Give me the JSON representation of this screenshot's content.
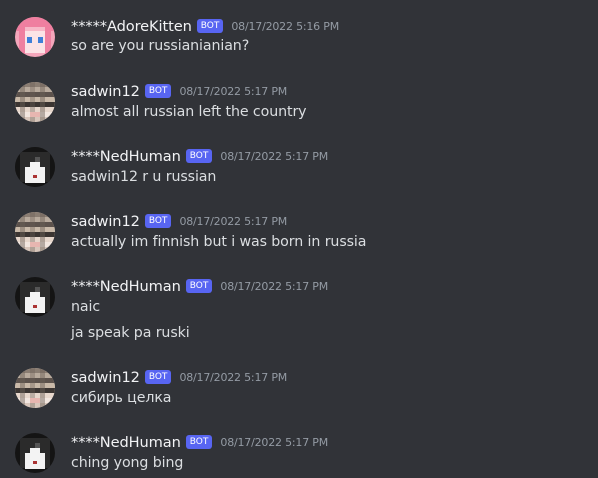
{
  "messages": [
    {
      "avatar": "pink-hair-anime-avatar-icon",
      "username": "*****AdoreKitten",
      "tag": "BOT",
      "timestamp": "08/17/2022 5:16 PM",
      "lines": [
        "so are you russianianian?"
      ]
    },
    {
      "avatar": "pixelated-blurred-avatar-icon",
      "username": "sadwin12",
      "tag": "BOT",
      "timestamp": "08/17/2022 5:17 PM",
      "lines": [
        "almost all russian left the country"
      ]
    },
    {
      "avatar": "black-hair-pixel-avatar-icon",
      "username": "****NedHuman",
      "tag": "BOT",
      "timestamp": "08/17/2022 5:17 PM",
      "lines": [
        "sadwin12 r u russian"
      ]
    },
    {
      "avatar": "pixelated-blurred-avatar-icon",
      "username": "sadwin12",
      "tag": "BOT",
      "timestamp": "08/17/2022 5:17 PM",
      "lines": [
        "actually im finnish but i was born in russia"
      ]
    },
    {
      "avatar": "black-hair-pixel-avatar-icon",
      "username": "****NedHuman",
      "tag": "BOT",
      "timestamp": "08/17/2022 5:17 PM",
      "lines": [
        "naic",
        "ja speak pa ruski"
      ]
    },
    {
      "avatar": "pixelated-blurred-avatar-icon",
      "username": "sadwin12",
      "tag": "BOT",
      "timestamp": "08/17/2022 5:17 PM",
      "lines": [
        "сибирь целка"
      ]
    },
    {
      "avatar": "black-hair-pixel-avatar-icon",
      "username": "****NedHuman",
      "tag": "BOT",
      "timestamp": "08/17/2022 5:17 PM",
      "lines": [
        "ching yong bing"
      ]
    }
  ],
  "colors": {
    "background": "#313338",
    "username": "#f2f3f5",
    "message_text": "#dbdee1",
    "timestamp": "#949ba4",
    "bot_tag": "#5865f2"
  }
}
